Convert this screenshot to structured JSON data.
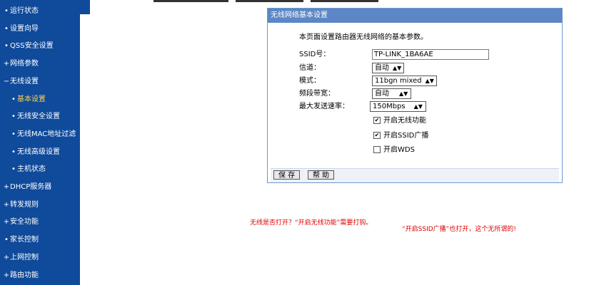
{
  "sidebar": {
    "items": [
      {
        "label": "运行状态",
        "sub": false
      },
      {
        "label": "设置向导",
        "sub": false
      },
      {
        "label": "QSS安全设置",
        "sub": false
      },
      {
        "label": "网络参数",
        "sub": false
      },
      {
        "label": "无线设置",
        "sub": false
      },
      {
        "label": "基本设置",
        "sub": true
      },
      {
        "label": "无线安全设置",
        "sub": true
      },
      {
        "label": "无线MAC地址过滤",
        "sub": true
      },
      {
        "label": "无线高级设置",
        "sub": true
      },
      {
        "label": "主机状态",
        "sub": true
      },
      {
        "label": "DHCP服务器",
        "sub": false
      },
      {
        "label": "转发规则",
        "sub": false
      },
      {
        "label": "安全功能",
        "sub": false
      },
      {
        "label": "家长控制",
        "sub": false
      },
      {
        "label": "上网控制",
        "sub": false
      },
      {
        "label": "路由功能",
        "sub": false
      }
    ]
  },
  "panel": {
    "title": "无线网络基本设置",
    "description": "本页面设置路由器无线网络的基本参数。",
    "fields": {
      "ssid": {
        "label": "SSID号：",
        "value": "TP-LINK_1BA6AE"
      },
      "channel": {
        "label": "信道：",
        "value": "自动"
      },
      "mode": {
        "label": "模式：",
        "value": "11bgn mixed"
      },
      "bandwidth": {
        "label": "频段带宽：",
        "value": "自动"
      },
      "rate": {
        "label": "最大发送速率：",
        "value": "150Mbps"
      }
    },
    "checkboxes": {
      "enable_wireless": {
        "label": "开启无线功能",
        "checked": "✔"
      },
      "enable_ssid_broadcast": {
        "label": "开启SSID广播",
        "checked": "✔"
      },
      "enable_wds": {
        "label": "开启WDS",
        "checked": ""
      }
    },
    "buttons": {
      "save": "保 存",
      "help": "帮 助"
    }
  },
  "annotations": {
    "note1": "无线是否打开？“开启无线功能”需要打钩。",
    "note2": "“开启SSID广播”也打开，这个无所谓的!"
  },
  "colors": {
    "sidebar_bg": "#0f4a9b",
    "panel_title_bg": "#5c86c5",
    "annotation": "#e00000"
  }
}
